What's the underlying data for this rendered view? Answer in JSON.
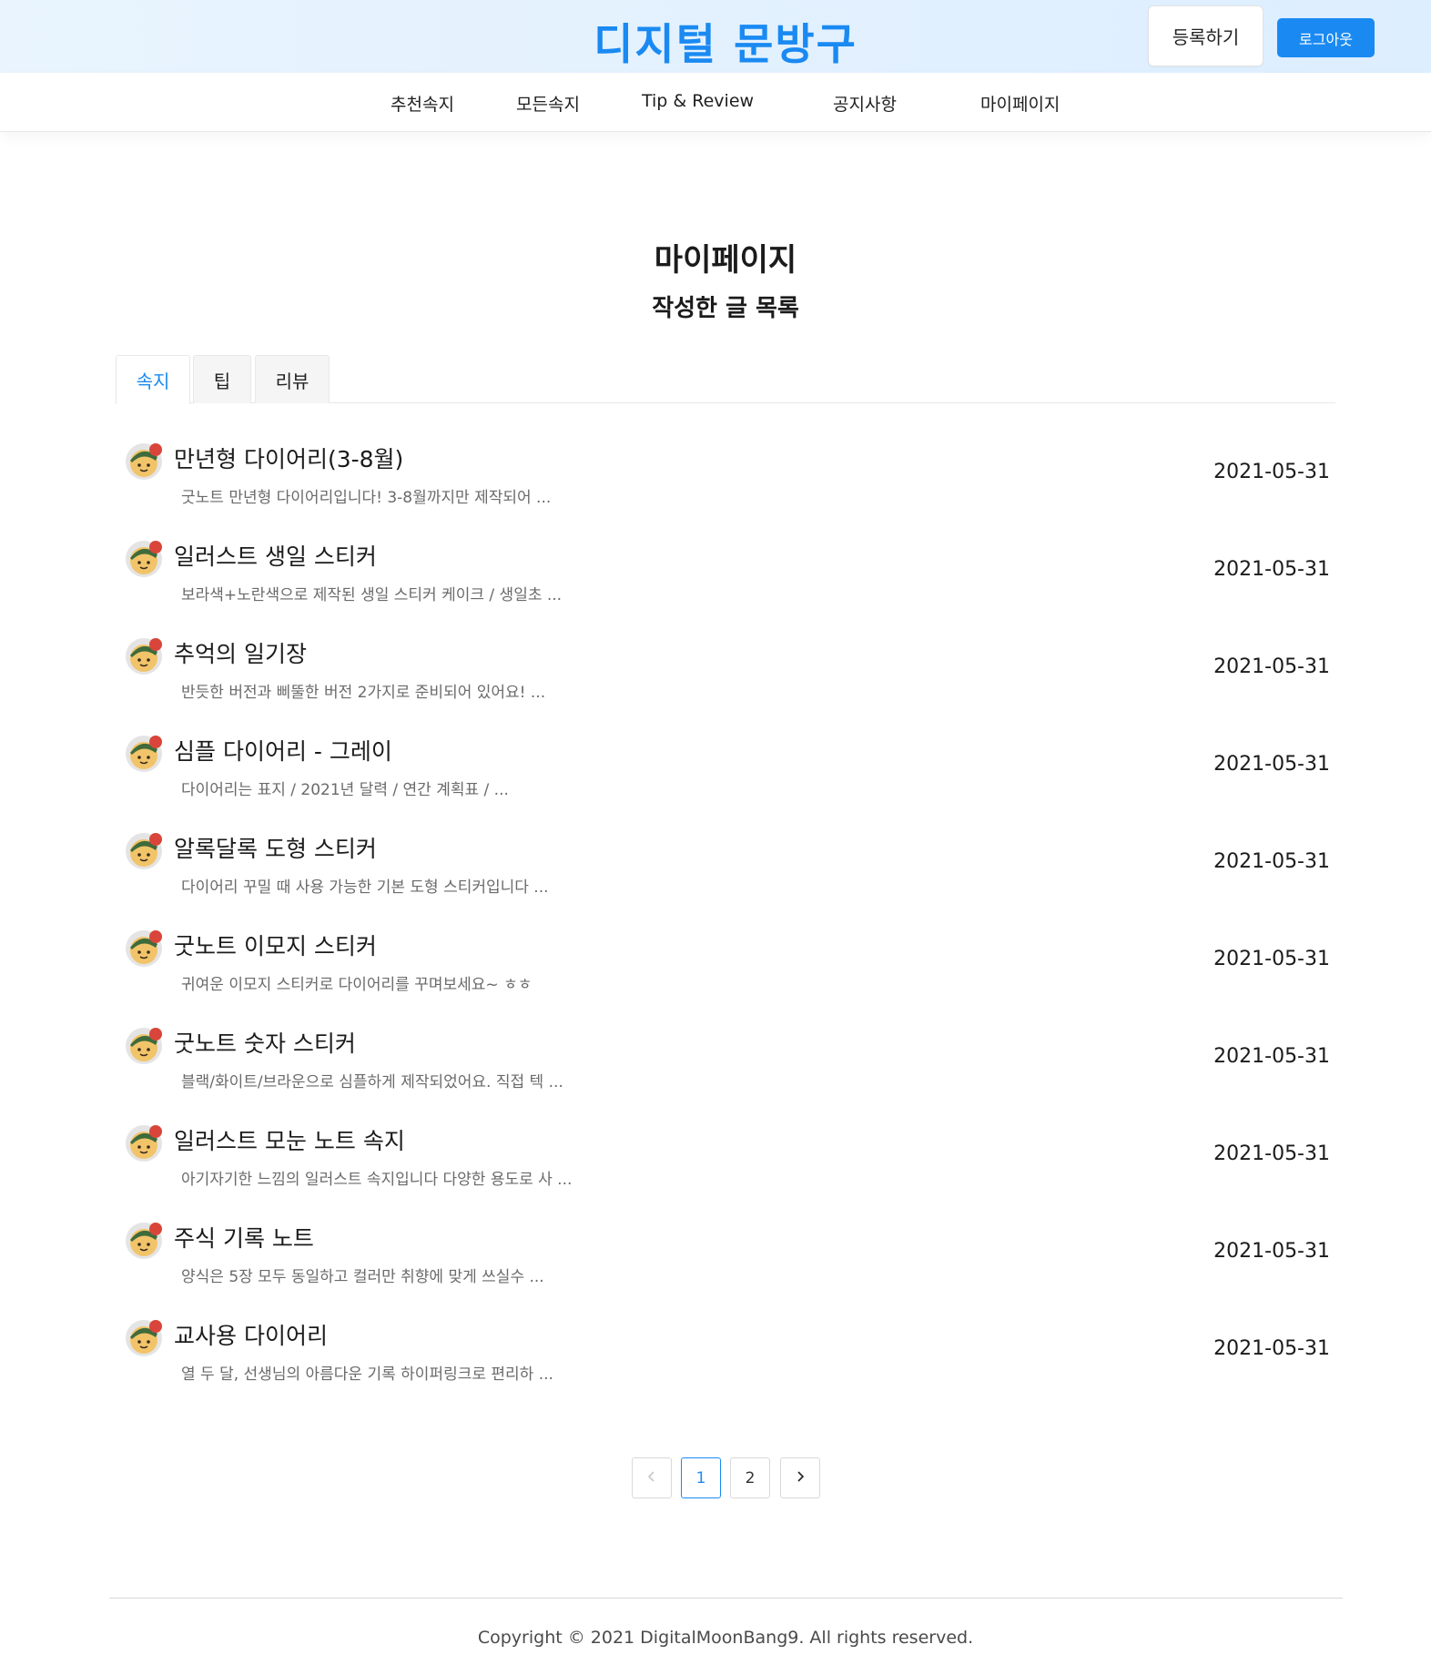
{
  "header": {
    "logo": "디지털 문방구",
    "register_label": "등록하기",
    "logout_label": "로그아웃"
  },
  "nav": {
    "items": [
      {
        "label": "추천속지"
      },
      {
        "label": "모든속지"
      },
      {
        "label": "Tip & Review"
      },
      {
        "label": "공지사항"
      },
      {
        "label": "마이페이지"
      }
    ]
  },
  "page": {
    "title": "마이페이지",
    "subtitle": "작성한 글 목록"
  },
  "tabs": [
    {
      "label": "속지",
      "active": true
    },
    {
      "label": "팁",
      "active": false
    },
    {
      "label": "리뷰",
      "active": false
    }
  ],
  "posts": [
    {
      "title": "만년형 다이어리(3-8월)",
      "excerpt": "굿노트 만년형 다이어리입니다! 3-8월까지만 제작되어 ...",
      "date": "2021-05-31"
    },
    {
      "title": "일러스트 생일 스티커",
      "excerpt": "보라색+노란색으로 제작된 생일 스티커 케이크 / 생일초 ...",
      "date": "2021-05-31"
    },
    {
      "title": "추억의 일기장",
      "excerpt": "반듯한 버전과 삐뚤한 버전 2가지로 준비되어 있어요! ...",
      "date": "2021-05-31"
    },
    {
      "title": "심플 다이어리 - 그레이",
      "excerpt": "다이어리는 표지 / 2021년 달력 / 연간 계획표 / ...",
      "date": "2021-05-31"
    },
    {
      "title": "알록달록 도형 스티커",
      "excerpt": "다이어리 꾸밀 때 사용 가능한 기본 도형 스티커입니다 ...",
      "date": "2021-05-31"
    },
    {
      "title": "굿노트 이모지 스티커",
      "excerpt": "귀여운 이모지 스티커로 다이어리를 꾸며보세요~ ㅎㅎ",
      "date": "2021-05-31"
    },
    {
      "title": "굿노트 숫자 스티커",
      "excerpt": "블랙/화이트/브라운으로 심플하게 제작되었어요. 직접 텍 ...",
      "date": "2021-05-31"
    },
    {
      "title": "일러스트 모눈 노트 속지",
      "excerpt": "아기자기한 느낌의 일러스트 속지입니다 다양한 용도로 사 ...",
      "date": "2021-05-31"
    },
    {
      "title": "주식 기록 노트",
      "excerpt": "양식은 5장 모두 동일하고 컬러만 취향에 맞게 쓰실수 ...",
      "date": "2021-05-31"
    },
    {
      "title": "교사용 다이어리",
      "excerpt": "열 두 달, 선생님의 아름다운 기록 하이퍼링크로 편리하 ...",
      "date": "2021-05-31"
    }
  ],
  "pagination": {
    "prev_icon": "chevron-left-icon",
    "pages": [
      "1",
      "2"
    ],
    "current": "1",
    "next_icon": "chevron-right-icon"
  },
  "footer": {
    "copyright": "Copyright © 2021 DigitalMoonBang9. All rights reserved."
  },
  "colors": {
    "accent": "#1a8af2",
    "header_bg": "#e9f4fe"
  }
}
